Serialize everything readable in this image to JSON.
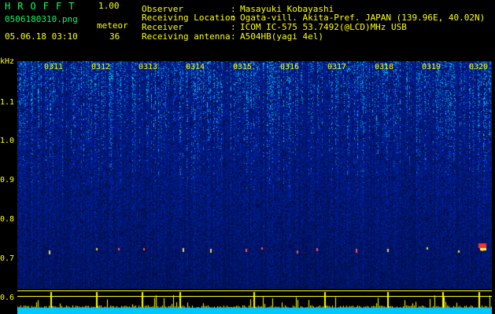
{
  "header": {
    "logo": "HROFFT",
    "version": "1.00",
    "filename": "0506180310.png",
    "timestamp": "05.06.18 03:10",
    "meteor_label": "meteor",
    "meteor_count": "36"
  },
  "station": {
    "observer_label": "Observer",
    "observer_value": "Masayuki Kobayashi",
    "location_label": "Receiving Location",
    "location_value": "Ogata-vill. Akita-Pref. JAPAN (139.96E, 40.02N)",
    "receiver_label": "Receiver",
    "receiver_value": "ICOM IC-575 53.7492(@LCD)MHz USB",
    "antenna_label": "Receiving antenna",
    "antenna_value": "A504HB(yagi 4el)",
    "separator": ":"
  },
  "axis": {
    "unit": "kHz",
    "y_ticks": [
      "1.1",
      "1.0",
      "0.9",
      "0.8",
      "0.7",
      "0.6"
    ],
    "x_ticks": [
      "0311",
      "0312",
      "0313",
      "0314",
      "0315",
      "0316",
      "0317",
      "0318",
      "0319",
      "0320"
    ]
  },
  "colors": {
    "background": "#000000",
    "label_yellow": "#ffff00",
    "logo_green": "#00ff66",
    "spectrum_base": "#0a1f8c",
    "activity_strip": "#00c8ff"
  }
}
